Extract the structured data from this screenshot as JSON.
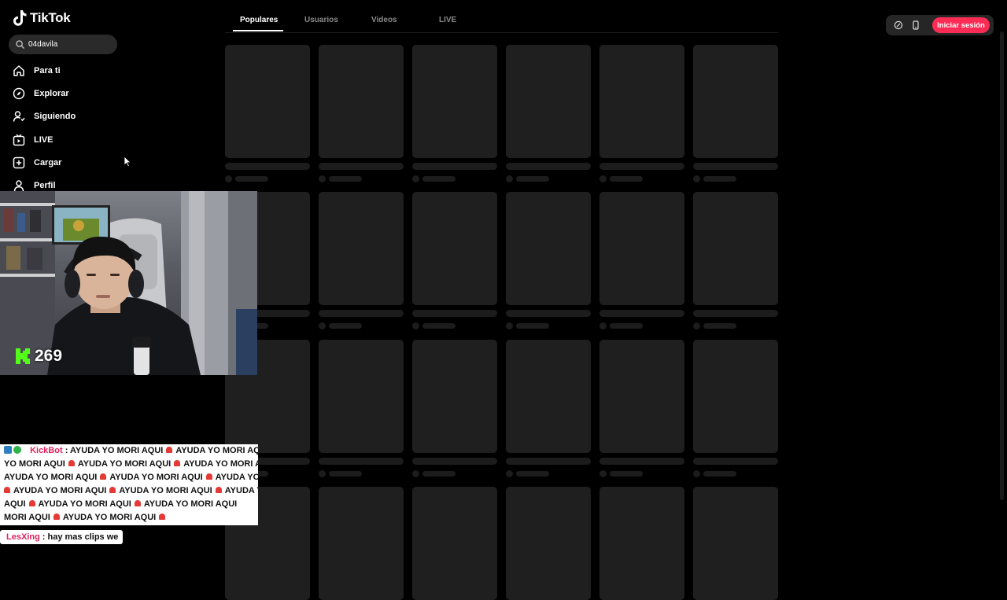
{
  "app": {
    "logo_text": "TikTok",
    "accent": "#fe2c55"
  },
  "search": {
    "value": "04davila",
    "icon": "search-icon"
  },
  "nav": {
    "items": [
      {
        "label": "Para ti",
        "icon": "home-icon"
      },
      {
        "label": "Explorar",
        "icon": "compass-icon"
      },
      {
        "label": "Siguiendo",
        "icon": "user-follow-icon"
      },
      {
        "label": "LIVE",
        "icon": "live-tv-icon"
      },
      {
        "label": "Cargar",
        "icon": "upload-plus-icon"
      },
      {
        "label": "Perfil",
        "icon": "profile-icon"
      }
    ]
  },
  "tabs": {
    "items": [
      {
        "label": "Populares",
        "active": true
      },
      {
        "label": "Usuarios",
        "active": false
      },
      {
        "label": "Videos",
        "active": false
      },
      {
        "label": "LIVE",
        "active": false
      }
    ]
  },
  "header": {
    "login_label": "Iniciar sesión"
  },
  "stream_overlay": {
    "viewer_count": "269",
    "chat": [
      {
        "user": "KickBot",
        "lines": [
          ": AYUDA YO MORI AQUI",
          "YO MORI AQUI",
          "AYUDA YO MORI AQUI",
          "AYUDA YO MORI AQUI",
          "AQUI",
          "MORI AQUI"
        ]
      },
      {
        "user": "LesXing",
        "text": ": hay mas clips we"
      }
    ],
    "repeated_phrase": "AYUDA YO MORI AQUI"
  }
}
